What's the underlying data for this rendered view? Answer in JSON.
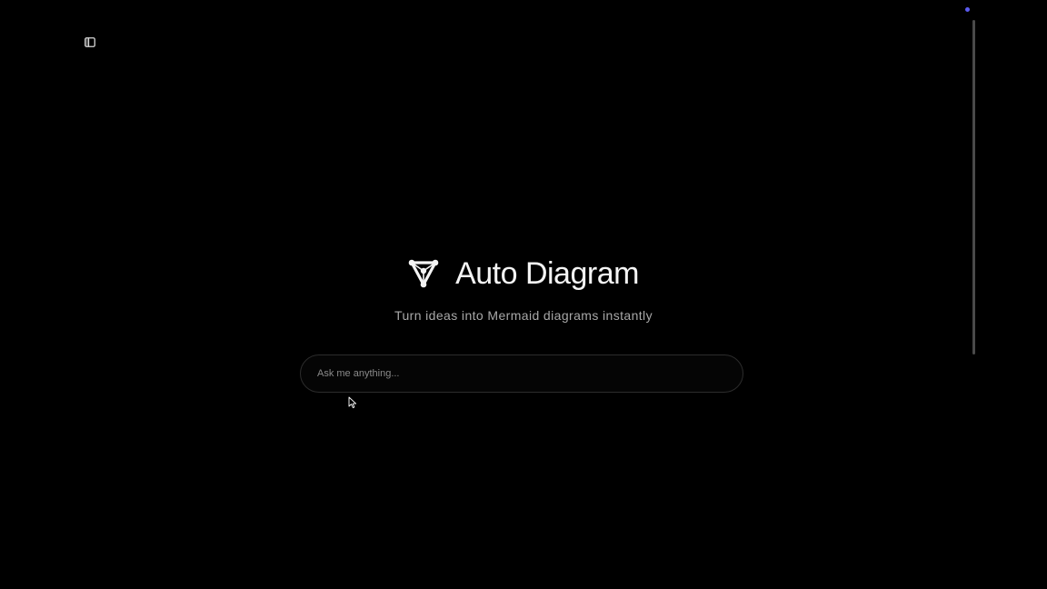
{
  "sidebar": {
    "toggle_icon": "sidebar-panel-icon"
  },
  "status": {
    "indicator_color": "#5b5bf0"
  },
  "hero": {
    "logo_icon": "triangle-nodes-icon",
    "title": "Auto Diagram",
    "tagline": "Turn ideas into Mermaid diagrams instantly"
  },
  "prompt": {
    "value": "",
    "placeholder": "Ask me anything..."
  },
  "colors": {
    "background": "#000000",
    "text_primary": "#f4f4f4",
    "text_secondary": "#a8a8a8",
    "input_border": "#2c2c2c",
    "accent": "#5b5bf0"
  }
}
